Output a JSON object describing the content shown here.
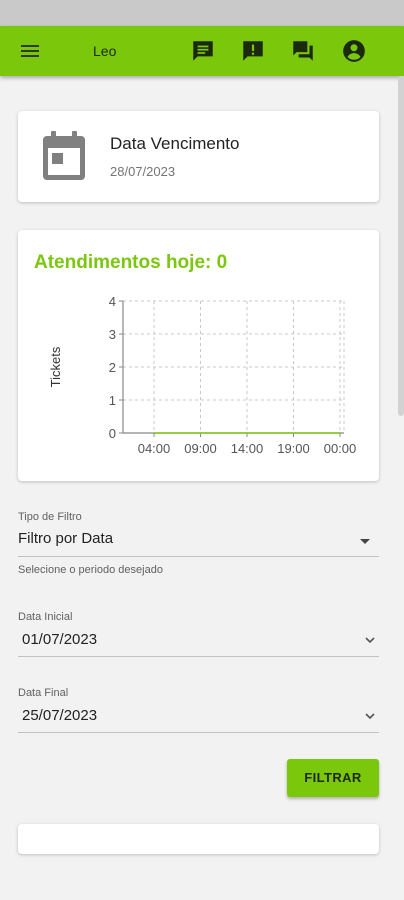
{
  "appbar": {
    "title": "Leo",
    "icons": [
      "menu-icon",
      "chat-icon",
      "alert-icon",
      "forum-icon",
      "account-icon"
    ]
  },
  "due_card": {
    "title": "Data Vencimento",
    "date": "28/07/2023",
    "icon": "calendar-icon"
  },
  "chart_card": {
    "title": "Atendimentos hoje: 0"
  },
  "chart_data": {
    "type": "line",
    "ylabel": "Tickets",
    "xlabel": "",
    "x": [
      "04:00",
      "09:00",
      "14:00",
      "19:00",
      "00:00"
    ],
    "y_ticks": [
      0,
      1,
      2,
      3,
      4
    ],
    "ylim": [
      0,
      4
    ],
    "grid": true,
    "series": [
      {
        "values": [
          0,
          0,
          0,
          0,
          0
        ]
      }
    ]
  },
  "filter": {
    "type_label": "Tipo de Filtro",
    "type_value": "Filtro por Data",
    "type_help": "Selecione o periodo desejado",
    "start_label": "Data Inicial",
    "start_value": "01/07/2023",
    "end_label": "Data Final",
    "end_value": "25/07/2023",
    "button_label": "FILTRAR"
  }
}
